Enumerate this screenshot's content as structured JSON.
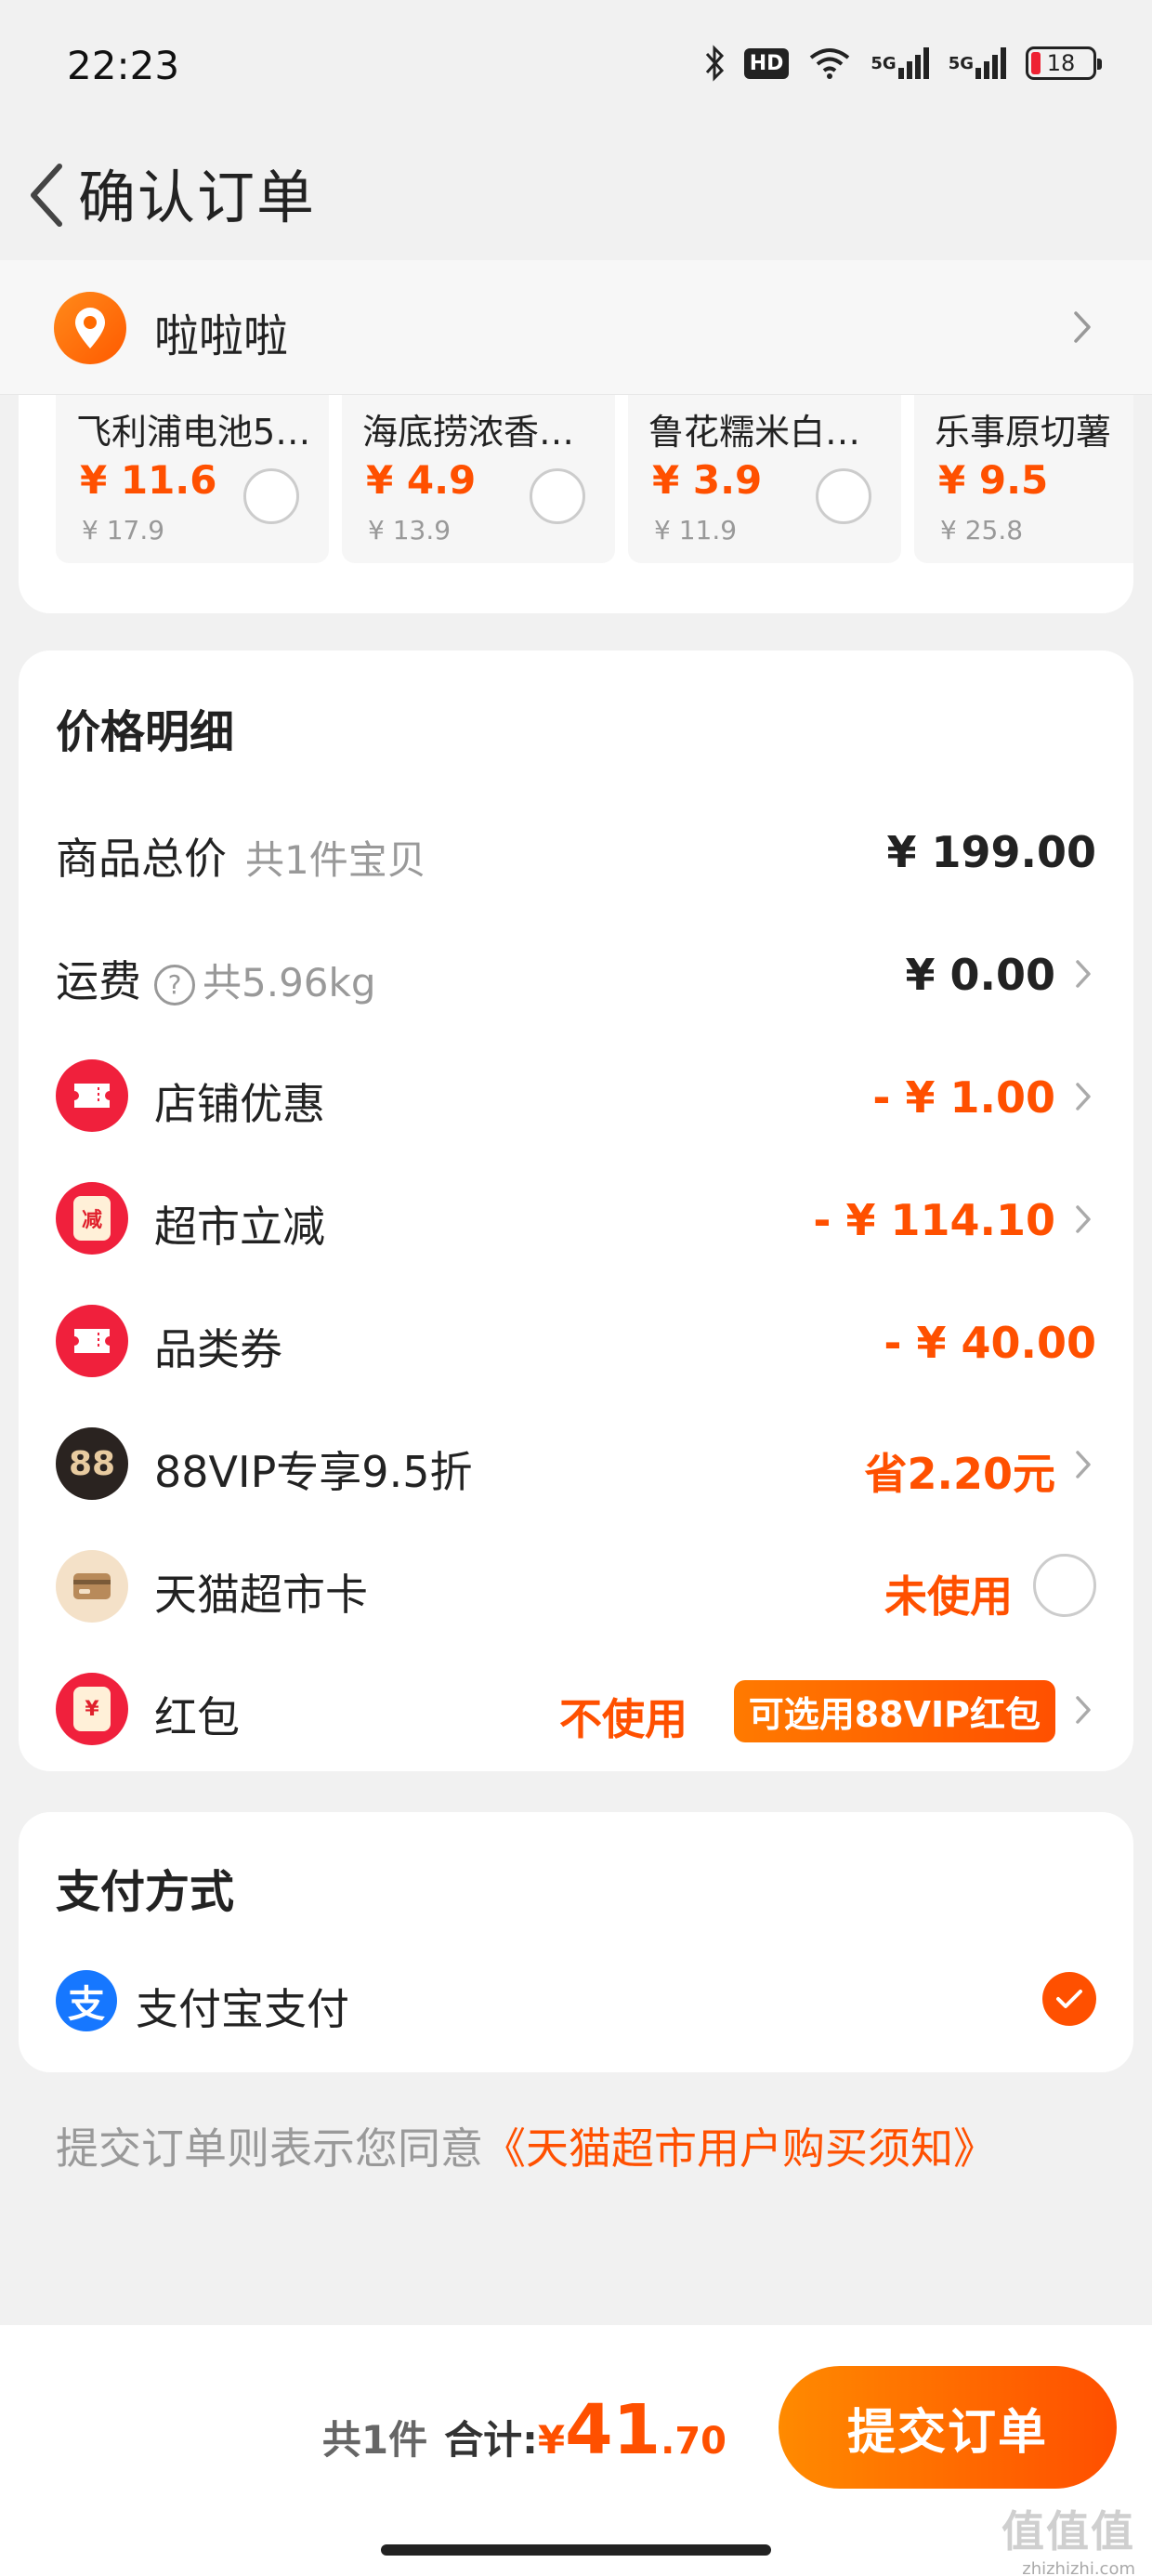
{
  "status_bar": {
    "time": "22:23",
    "hd_badge": "HD",
    "signal1": "5G",
    "signal2": "5G",
    "battery": "18"
  },
  "header": {
    "title": "确认订单"
  },
  "address": {
    "name": "啦啦啦"
  },
  "recommendations": [
    {
      "name": "飞利浦电池5/...",
      "price": "¥ 11.6",
      "orig": "¥ 17.9"
    },
    {
      "name": "海底捞浓香牛...",
      "price": "¥ 4.9",
      "orig": "¥ 13.9"
    },
    {
      "name": "鲁花糯米白醋...",
      "price": "¥ 3.9",
      "orig": "¥ 11.9"
    },
    {
      "name": "乐事原切薯",
      "price": "¥ 9.5",
      "orig": "¥ 25.8"
    }
  ],
  "price_detail": {
    "title": "价格明细",
    "goods_total": {
      "label": "商品总价",
      "sub": "共1件宝贝",
      "value": "¥ 199.00"
    },
    "shipping": {
      "label": "运费",
      "help": "?",
      "sub": "共5.96kg",
      "value": "¥ 0.00"
    },
    "shop_discount": {
      "label": "店铺优惠",
      "value": "- ¥ 1.00"
    },
    "market_cut": {
      "label": "超市立减",
      "icon_text": "减",
      "value": "- ¥ 114.10"
    },
    "category_coupon": {
      "label": "品类券",
      "value": "- ¥ 40.00"
    },
    "vip": {
      "label": "88VIP专享9.5折",
      "icon_text": "88",
      "value": "省2.20元"
    },
    "tmall_card": {
      "label": "天猫超市卡",
      "value": "未使用"
    },
    "red_packet": {
      "label": "红包",
      "icon_text": "¥",
      "value": "不使用",
      "tag": "可选用88VIP红包"
    }
  },
  "payment": {
    "title": "支付方式",
    "icon_text": "支",
    "method": "支付宝支付"
  },
  "agreement": {
    "prefix": "提交订单则表示您同意",
    "link": "《天猫超市用户购买须知》"
  },
  "bottom": {
    "count": "共1件",
    "total_label": "合计:",
    "currency": "¥",
    "total_int": "41",
    "total_dec": ".70",
    "submit": "提交订单",
    "watermark": "值值值",
    "watermark_url": "zhizhizhi.com"
  },
  "colors": {
    "accent": "#ff5000",
    "alipay": "#1677ff",
    "red_icon": "#f0203c"
  }
}
